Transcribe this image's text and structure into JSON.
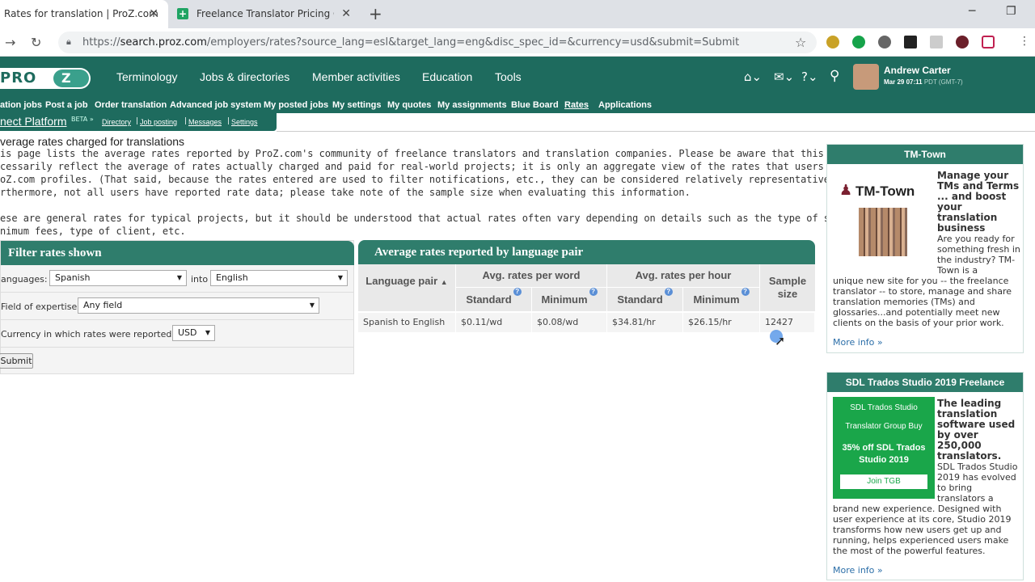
{
  "browser": {
    "tabs": [
      {
        "title": "Rates for translation | ProZ.com"
      },
      {
        "title": "Freelance Translator Pricing Guid"
      }
    ],
    "url_prefix": "https://",
    "url_host": "search.proz.com",
    "url_path": "/employers/rates?source_lang=esl&target_lang=eng&disc_spec_id=&currency=usd&submit=Submit"
  },
  "header": {
    "logo_text": "PRO",
    "logo_z": "Z",
    "nav": [
      "Terminology",
      "Jobs & directories",
      "Member activities",
      "Education",
      "Tools"
    ],
    "user_name": "Andrew Carter",
    "user_date": "Mar 29 07:11",
    "user_tz": "PDT (GMT-7)"
  },
  "subnav": [
    "ation jobs",
    "Post a job",
    "Order translation",
    "Advanced job system",
    "My posted jobs",
    "My settings",
    "My quotes",
    "My assignments",
    "Blue Board",
    "Rates",
    "Applications"
  ],
  "connect": {
    "title": "nect Platform",
    "beta": "BETA",
    "links": [
      "Directory",
      "Job posting",
      "Messages",
      "Settings"
    ]
  },
  "page": {
    "title": "verage rates charged for translations",
    "para1": [
      "is page lists the average rates reported by ProZ.com's community of freelance translators and translation companies. Please be aware that this data does not",
      "cessarily reflect the average of rates actually charged and paid for real-world projects; it is only an aggregate view of the rates that users have entered into their",
      "oZ.com profiles. (That said, because the rates entered are used to filter notifications, etc., they can be considered relatively representative of actual fees.)",
      "rthermore, not all users have reported rate data; please take note of the sample size when evaluating this information."
    ],
    "para2": [
      "ese are general rates for typical projects, but it should be understood that actual rates often vary depending on details such as the type of service, expertise required,",
      "nimum fees, type of client, etc."
    ]
  },
  "filter": {
    "title": "Filter rates shown",
    "languages_label": "anguages:",
    "source_lang": "Spanish",
    "into_label": "into",
    "target_lang": "English",
    "field_label": "Field of expertise:",
    "field_value": "Any field",
    "currency_label": "Currency in which rates were reported:",
    "currency_value": "USD",
    "submit_label": "Submit"
  },
  "rates": {
    "title": "Average rates reported by language pair",
    "col_pair": "Language pair",
    "col_word": "Avg. rates per word",
    "col_hour": "Avg. rates per hour",
    "col_sample": "Sample size",
    "sub_standard": "Standard",
    "sub_minimum": "Minimum",
    "row": {
      "pair": "Spanish to English",
      "word_standard": "$0.11/wd",
      "word_minimum": "$0.08/wd",
      "hour_standard": "$34.81/hr",
      "hour_minimum": "$26.15/hr",
      "sample": "12427"
    }
  },
  "sidebar": {
    "tmtown": {
      "title": "TM-Town",
      "logo": "TM-Town",
      "tagline": "Manage your TMs and Terms ... and boost your translation business",
      "body_short": "Are you ready for something fresh in the industry? TM-Town is a",
      "body_long": "unique new site for you -- the freelance translator -- to store, manage and share translation memories (TMs) and glossaries...and potentially meet new clients on the basis of your prior work.",
      "more": "More info »"
    },
    "sdl": {
      "title": "SDL Trados Studio 2019 Freelance",
      "img_line1": "SDL Trados Studio",
      "img_line2": "Translator Group Buy",
      "img_line3": "35% off SDL Trados Studio 2019",
      "img_button": "Join TGB",
      "tagline": "The leading translation software used by over 250,000 translators.",
      "body_short": "SDL Trados Studio 2019 has evolved to bring translators a",
      "body_long": "brand new experience. Designed with user experience at its core, Studio 2019 transforms how new users get up and running, helps experienced users make the most of the powerful features.",
      "more": "More info »"
    }
  },
  "colors": {
    "brand": "#1e6b5e",
    "panel_head": "#2f7d6c",
    "link": "#2b6ea8"
  }
}
